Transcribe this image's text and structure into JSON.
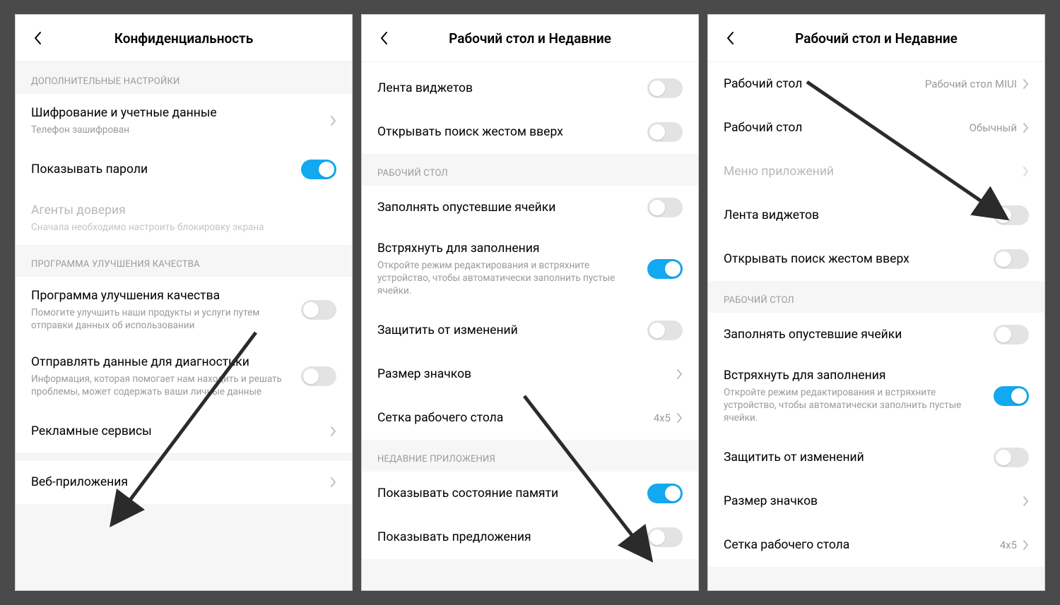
{
  "panel1": {
    "title": "Конфиденциальность",
    "sec1_label": "ДОПОЛНИТЕЛЬНЫЕ НАСТРОЙКИ",
    "enc_title": "Шифрование и учетные данные",
    "enc_sub": "Телефон зашифрован",
    "show_pw": "Показывать пароли",
    "trust_title": "Агенты доверия",
    "trust_sub": "Сначала необходимо настроить блокировку экрана",
    "sec2_label": "ПРОГРАММА УЛУЧШЕНИЯ КАЧЕСТВА",
    "qp_title": "Программа улучшения качества",
    "qp_sub": "Помогите улучшить наши продукты и услуги путем отправки данных об использовании",
    "diag_title": "Отправлять данные для диагностики",
    "diag_sub": "Информация, которая помогает нам находить и решать проблемы, может содержать ваши личные данные",
    "ads": "Рекламные сервисы",
    "web": "Веб-приложения"
  },
  "panel2": {
    "title": "Рабочий стол и Недавние",
    "widget_feed": "Лента виджетов",
    "search_gesture": "Открывать поиск жестом вверх",
    "sec_desktop": "РАБОЧИЙ СТОЛ",
    "fill_cells": "Заполнять опустевшие ячейки",
    "shake_title": "Встряхнуть для заполнения",
    "shake_sub": "Откройте режим редактирования и встряхните устройство, чтобы автоматически заполнить пустые ячейки.",
    "lock_layout": "Защитить от изменений",
    "icon_size": "Размер значков",
    "grid": "Сетка рабочего стола",
    "grid_val": "4x5",
    "sec_recent": "НЕДАВНИЕ ПРИЛОЖЕНИЯ",
    "mem_status": "Показывать состояние памяти",
    "suggestions": "Показывать предложения"
  },
  "panel3": {
    "title": "Рабочий стол и Недавние",
    "launcher": "Рабочий стол",
    "launcher_val": "Рабочий стол MIUI",
    "mode": "Рабочий стол",
    "mode_val": "Обычный",
    "app_drawer": "Меню приложений",
    "widget_feed": "Лента виджетов",
    "search_gesture": "Открывать поиск жестом вверх",
    "sec_desktop": "РАБОЧИЙ СТОЛ",
    "fill_cells": "Заполнять опустевшие ячейки",
    "shake_title": "Встряхнуть для заполнения",
    "shake_sub": "Откройте режим редактирования и встряхните устройство, чтобы автоматически заполнить пустые ячейки.",
    "lock_layout": "Защитить от изменений",
    "icon_size": "Размер значков",
    "grid": "Сетка рабочего стола",
    "grid_val": "4x5"
  }
}
